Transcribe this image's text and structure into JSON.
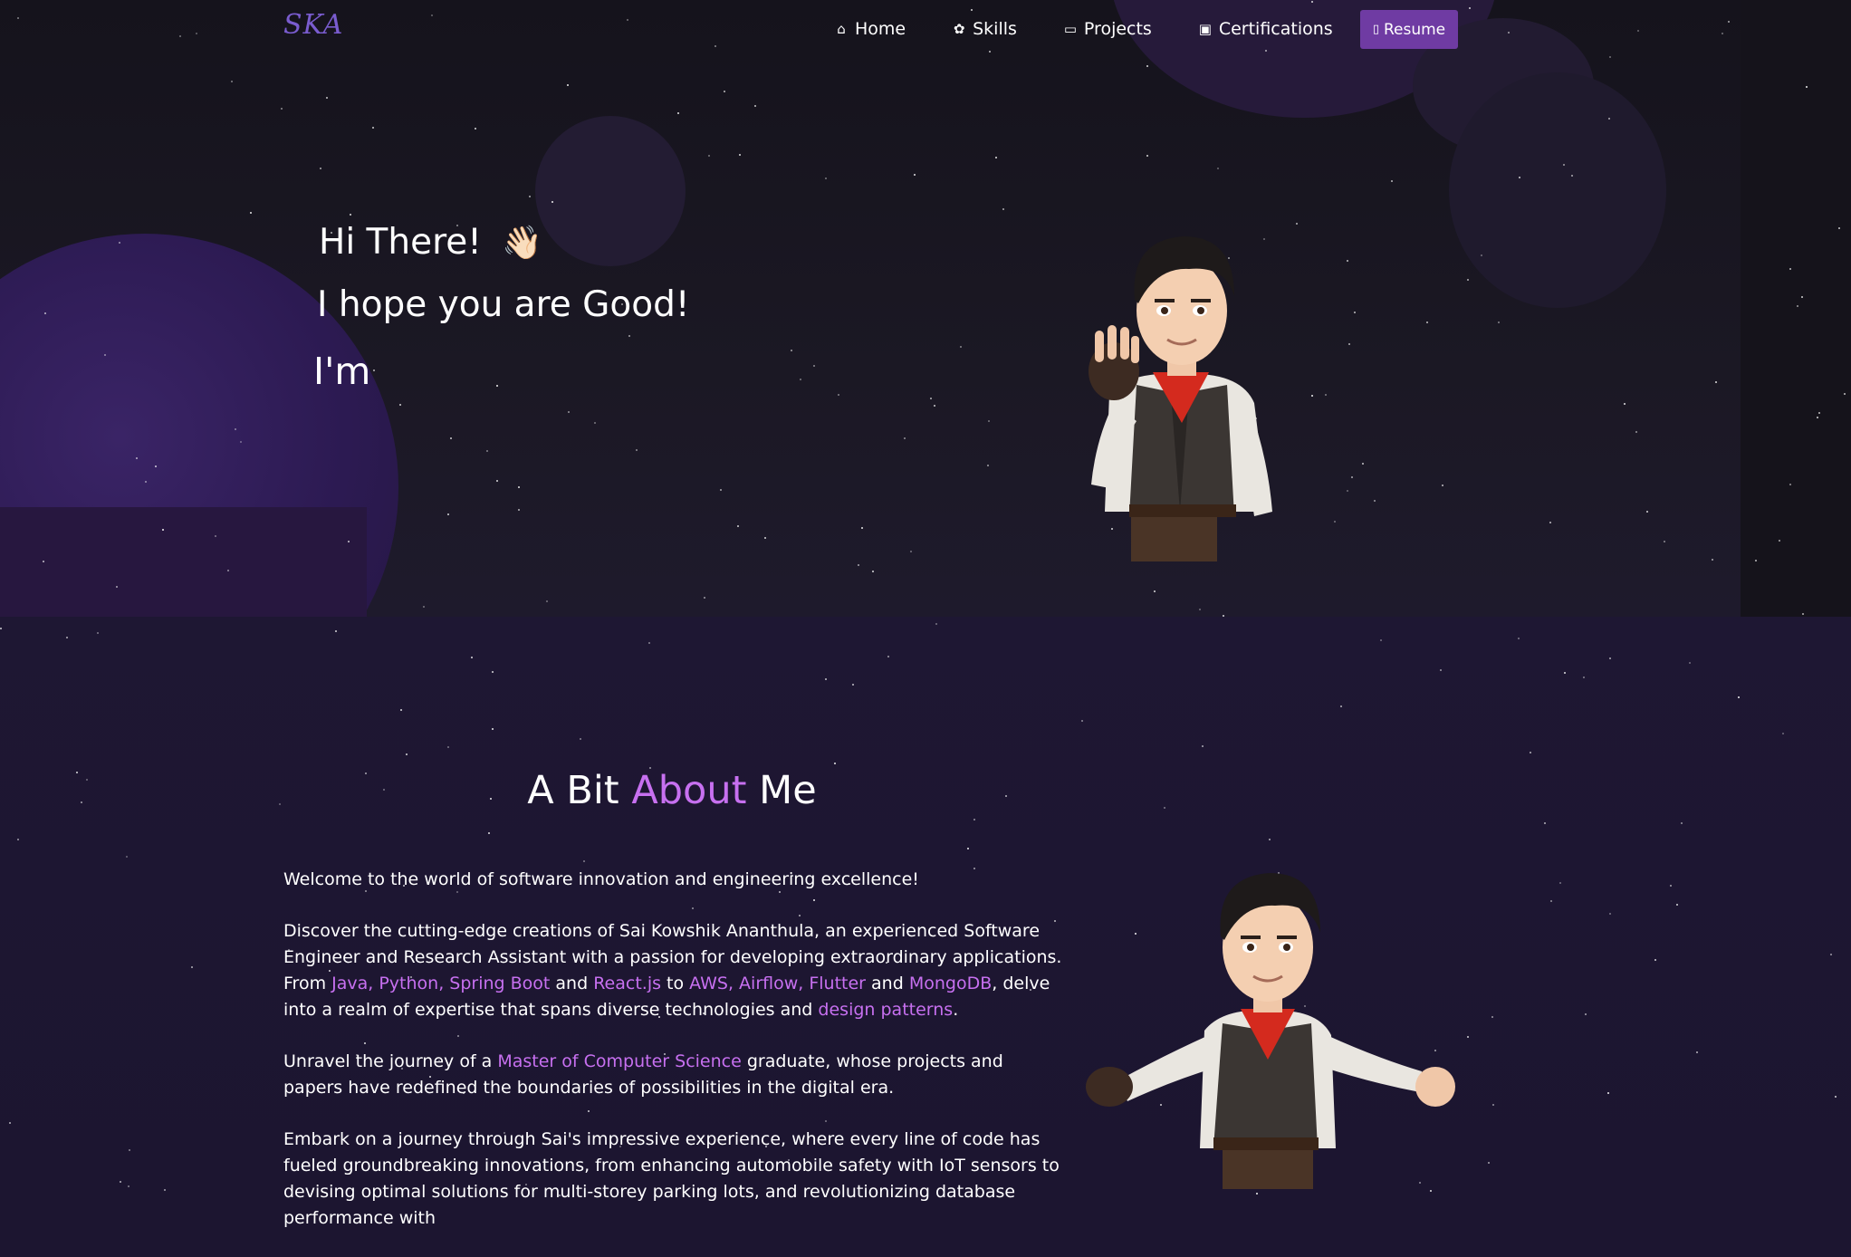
{
  "nav": {
    "logo": "SKA",
    "items": [
      {
        "label": "Home",
        "icon": "home-icon"
      },
      {
        "label": "Skills",
        "icon": "brain-icon"
      },
      {
        "label": "Projects",
        "icon": "presentation-icon"
      },
      {
        "label": "Certifications",
        "icon": "certificate-icon"
      }
    ],
    "resume_label": "Resume",
    "resume_icon": "document-icon"
  },
  "hero": {
    "greeting": "Hi There!",
    "wave_emoji": "👋🏻",
    "line2": "I hope you are Good!",
    "line3": "I'm"
  },
  "about": {
    "title_part1": "A Bit",
    "title_accent": "About",
    "title_part2": "Me",
    "p1": "Welcome to the world of software innovation and engineering excellence!",
    "p2": {
      "t1": "Discover the cutting-edge creations of Sai Kowshik Ananthula, an experienced Software Engineer and Research Assistant with a passion for developing extraordinary applications. From ",
      "h1": "Java, Python, Spring Boot",
      "t2": " and ",
      "h2": "React.js",
      "t3": " to ",
      "h3": "AWS, Airflow, Flutter",
      "t4": " and ",
      "h4": "MongoDB",
      "t5": ", delve into a realm of expertise that spans diverse technologies and ",
      "h5": "design patterns",
      "t6": "."
    },
    "p3": {
      "t1": "Unravel the journey of a ",
      "h1": "Master of Computer Science",
      "t2": " graduate, whose projects and papers have redefined the boundaries of possibilities in the digital era."
    },
    "p4": "Embark on a journey through Sai's impressive experience, where every line of code has fueled groundbreaking innovations, from enhancing automobile safety with IoT sensors to devising optimal solutions for multi-storey parking lots, and revolutionizing database performance with"
  },
  "colors": {
    "accent": "#c770f0",
    "button": "#6f3ba3",
    "logo": "#7a5ccf",
    "background": "#1c1530"
  }
}
